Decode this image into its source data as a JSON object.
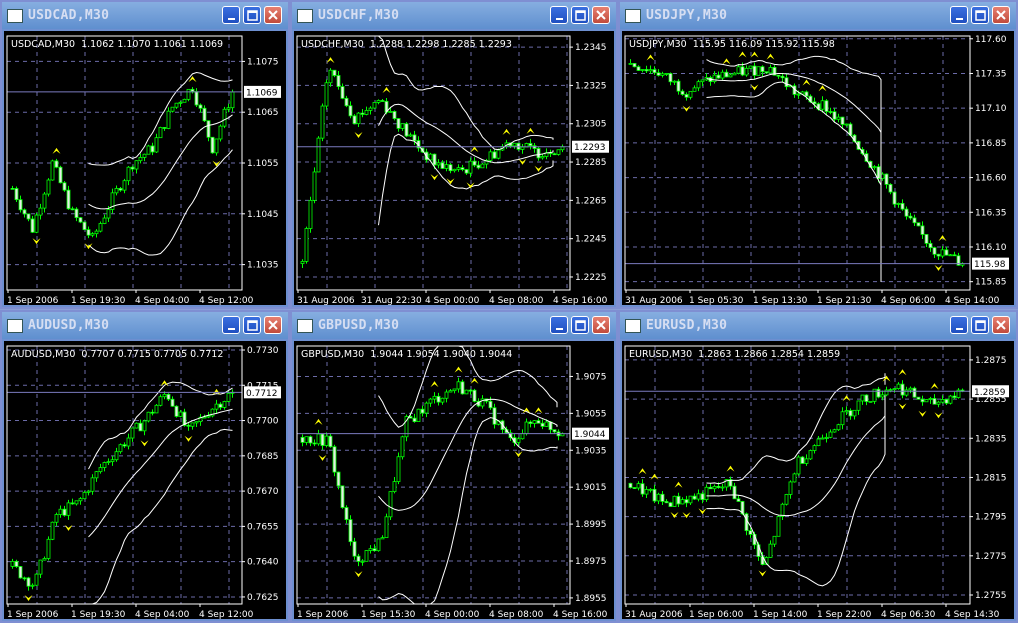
{
  "colors": {
    "bull": "#00ff00",
    "wick": "#00ff00",
    "bands": "#ffffff",
    "fractal": "#ffff00",
    "grid": "#6b6ba8",
    "price_line": "#7b7bc0"
  },
  "windows": [
    {
      "title": "USDCAD,M30",
      "symbol": "USDCAD,M30",
      "ohlc": "1.1062 1.1070 1.1061 1.1069",
      "price": "1.1069",
      "y_ticks": [
        "1.1075",
        "1.1065",
        "1.1055",
        "1.1045",
        "1.1035"
      ],
      "x_ticks": [
        "1 Sep 2006",
        "1 Sep 19:30",
        "4 Sep 04:00",
        "4 Sep 12:00"
      ],
      "chart": {
        "ylim": [
          1.103,
          1.108
        ],
        "closes": [
          1.105,
          1.1042,
          1.1055,
          1.1045,
          1.104,
          1.1048,
          1.1055,
          1.1058,
          1.1066,
          1.107,
          1.1058,
          1.1069
        ]
      }
    },
    {
      "title": "USDCHF,M30",
      "symbol": "USDCHF,M30",
      "ohlc": "1.2288 1.2298 1.2285 1.2293",
      "price": "1.2293",
      "y_ticks": [
        "1.2345",
        "1.2325",
        "1.2305",
        "1.2285",
        "1.2265",
        "1.2245",
        "1.2225"
      ],
      "x_ticks": [
        "31 Aug 2006",
        "31 Aug 22:30",
        "4 Sep 00:00",
        "4 Sep 08:00",
        "4 Sep 16:00"
      ],
      "chart": {
        "ylim": [
          1.22182,
          1.23508
        ],
        "closes": [
          1.2232,
          1.2335,
          1.2308,
          1.2318,
          1.23,
          1.2285,
          1.228,
          1.2286,
          1.2296,
          1.229,
          1.2293
        ]
      }
    },
    {
      "title": "USDJPY,M30",
      "symbol": "USDJPY,M30",
      "ohlc": "115.95 116.09 115.92 115.98",
      "price": "115.98",
      "y_ticks": [
        "117.60",
        "117.35",
        "117.10",
        "116.85",
        "116.60",
        "116.35",
        "116.10",
        "115.85"
      ],
      "x_ticks": [
        "31 Aug 2006",
        "1 Sep 05:30",
        "1 Sep 13:30",
        "1 Sep 21:30",
        "4 Sep 06:00",
        "4 Sep 14:00"
      ],
      "chart": {
        "ylim": [
          115.79,
          117.62
        ],
        "closes": [
          117.42,
          117.36,
          117.22,
          117.32,
          117.36,
          117.4,
          117.2,
          117.12,
          116.9,
          116.62,
          116.3,
          116.08,
          115.98
        ]
      }
    },
    {
      "title": "AUDUSD,M30",
      "symbol": "AUDUSD,M30",
      "ohlc": "0.7707 0.7715 0.7705 0.7712",
      "price": "0.7712",
      "y_ticks": [
        "0.7730",
        "0.7715",
        "0.7700",
        "0.7685",
        "0.7670",
        "0.7655",
        "0.7640",
        "0.7625"
      ],
      "x_ticks": [
        "1 Sep 2006",
        "1 Sep 19:30",
        "4 Sep 04:00",
        "4 Sep 12:00"
      ],
      "chart": {
        "ylim": [
          0.7622,
          0.77317
        ],
        "closes": [
          0.7638,
          0.763,
          0.766,
          0.7665,
          0.768,
          0.769,
          0.77,
          0.7712,
          0.7695,
          0.7705,
          0.7712
        ]
      }
    },
    {
      "title": "GBPUSD,M30",
      "symbol": "GBPUSD,M30",
      "ohlc": "1.9044 1.9054 1.9040 1.9044",
      "price": "1.9044",
      "y_ticks": [
        "1.9075",
        "1.9055",
        "1.9035",
        "1.9015",
        "1.8995",
        "1.8975",
        "1.8955"
      ],
      "x_ticks": [
        "1 Sep 2006",
        "1 Sep 15:30",
        "4 Sep 00:00",
        "4 Sep 08:00",
        "4 Sep 16:00"
      ],
      "chart": {
        "ylim": [
          1.89517,
          1.90915
        ],
        "closes": [
          1.9042,
          1.904,
          1.8975,
          1.8985,
          1.905,
          1.9062,
          1.907,
          1.906,
          1.904,
          1.9052,
          1.9044
        ]
      }
    },
    {
      "title": "EURUSD,M30",
      "symbol": "EURUSD,M30",
      "ohlc": "1.2863 1.2866 1.2854 1.2859",
      "price": "1.2859",
      "y_ticks": [
        "1.2875",
        "1.2855",
        "1.2835",
        "1.2815",
        "1.2795",
        "1.2775",
        "1.2755"
      ],
      "x_ticks": [
        "31 Aug 2006",
        "1 Sep 06:00",
        "1 Sep 14:00",
        "1 Sep 22:00",
        "4 Sep 06:30",
        "4 Sep 14:30"
      ],
      "chart": {
        "ylim": [
          1.27504,
          1.28821
        ],
        "closes": [
          1.2812,
          1.2802,
          1.2805,
          1.2812,
          1.2768,
          1.2822,
          1.284,
          1.2855,
          1.2862,
          1.2852,
          1.2859
        ]
      }
    }
  ]
}
